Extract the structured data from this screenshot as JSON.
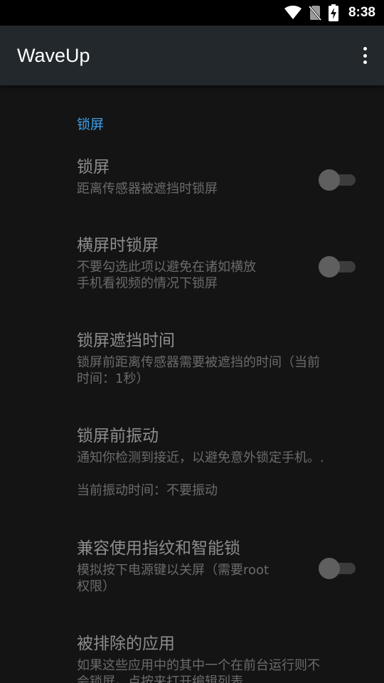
{
  "status_bar": {
    "time": "8:38",
    "icons": [
      "wifi-icon",
      "no-sim-icon",
      "battery-charging-icon"
    ]
  },
  "app_bar": {
    "title": "WaveUp",
    "menu_icon": "overflow-menu-icon"
  },
  "settings": {
    "category": "锁屏",
    "lock_screen": {
      "title": "锁屏",
      "summary": "距离传感器被遮挡时锁屏",
      "enabled": false
    },
    "lock_landscape": {
      "title": "横屏时锁屏",
      "summary_line1": "不要勾选此项以避免在诸如横放",
      "summary_line2": "手机看视频的情况下锁屏",
      "enabled": false
    },
    "lock_cover_time": {
      "title": "锁屏遮挡时间",
      "summary_line1": "锁屏前距离传感器需要被遮挡的时间（当前",
      "summary_line2": "时间：1秒）"
    },
    "vibrate_before_lock": {
      "title": "锁屏前振动",
      "summary_line1": "通知你检测到接近，以避免意外锁定手机。.",
      "summary_line2": "当前振动时间：不要振动"
    },
    "fingerprint_compat": {
      "title": "兼容使用指纹和智能锁",
      "summary_line1": "模拟按下电源键以关屏（需要root",
      "summary_line2": "权限）",
      "enabled": false
    },
    "excluded_apps": {
      "title": "被排除的应用",
      "summary_line1": "如果这些应用中的其中一个在前台运行则不",
      "summary_line2": "会锁屏。点按来打开编辑列表"
    }
  }
}
